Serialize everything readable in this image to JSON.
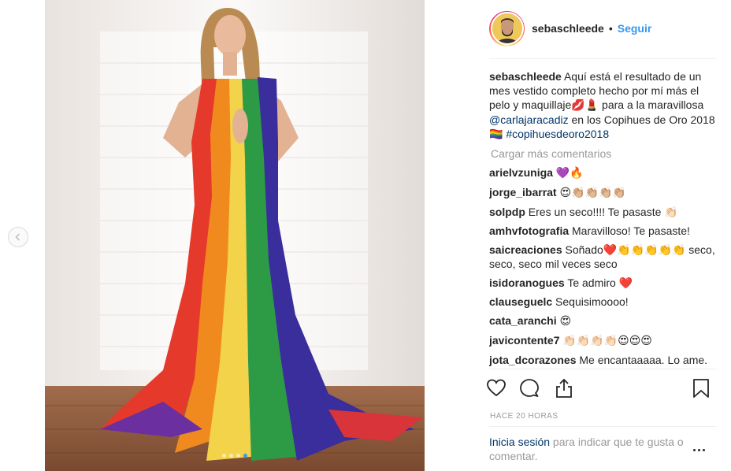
{
  "post": {
    "image_dots": 4,
    "active_dot": 3,
    "colors": {
      "link": "#003569",
      "follow": "#3897f0",
      "muted": "#999999"
    }
  },
  "header": {
    "username": "sebaschleede",
    "separator": "•",
    "follow": "Seguir"
  },
  "caption": {
    "username": "sebaschleede",
    "text_1": "Aquí está el resultado de un mes vestido completo hecho por mí más el pelo y maquillaje",
    "emoji_1": "💋💄",
    "text_2": " para a la maravillosa ",
    "mention": "@carlajaracadiz",
    "text_3": " en los Copihues de Oro 2018 ",
    "emoji_2": "🏳️‍🌈",
    "hashtag": "#copihuesdeoro2018"
  },
  "load_more": "Cargar más comentarios",
  "comments": [
    {
      "user": "arielvzuniga",
      "text": "💜🔥"
    },
    {
      "user": "jorge_ibarrat",
      "text": "😍👏🏼👏🏼👏🏼👏🏼"
    },
    {
      "user": "solpdp",
      "text": "Eres un seco!!!! Te pasaste 👏🏻"
    },
    {
      "user": "amhvfotografia",
      "text": "Maravilloso! Te pasaste!"
    },
    {
      "user": "saicreaciones",
      "text": "Soñado❤️👏👏👏👏👏 seco, seco, seco mil veces seco"
    },
    {
      "user": "isidoranogues",
      "text": "Te admiro ❤️"
    },
    {
      "user": "clauseguelc",
      "text": "Sequisimoooo!"
    },
    {
      "user": "cata_aranchi",
      "text": "😍"
    },
    {
      "user": "javicontente7",
      "text": "👏🏻👏🏻👏🏻👏🏻😍😍😍"
    },
    {
      "user": "jota_dcorazones",
      "text": "Me encantaaaaa. Lo ame."
    }
  ],
  "time": "HACE 20 HORAS",
  "login": {
    "link": "Inicia sesión",
    "text": " para indicar que te gusta o comentar."
  }
}
